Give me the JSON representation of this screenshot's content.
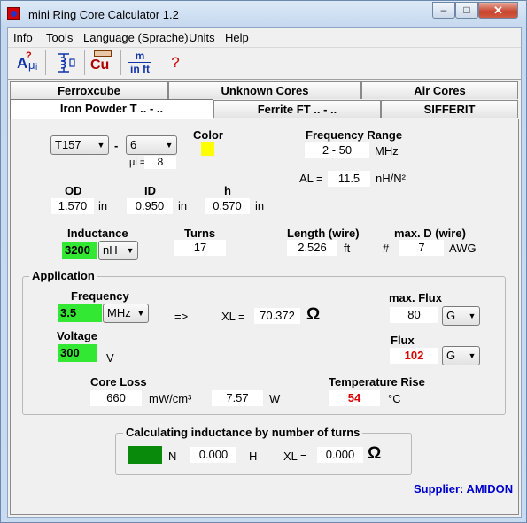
{
  "window": {
    "title": "mini Ring Core Calculator 1.2",
    "buttons": {
      "minimize": "–",
      "maximize": "□",
      "close": "✕"
    }
  },
  "menu": [
    "Info",
    "Tools",
    "Language (Sprache)",
    "Units",
    "Help"
  ],
  "toolbar": {
    "b1_a": "A",
    "b1_b": "?",
    "b1_c": "μ",
    "b1_d": "i",
    "b3": "Cu",
    "b4_top": "m",
    "b4_bottom": "in ft",
    "b5": "?"
  },
  "tabs": {
    "row1": [
      "Ferroxcube",
      "Unknown Cores",
      "Air Cores"
    ],
    "row2": [
      "Iron Powder T .. - ..",
      "Ferrite FT .. - ..",
      "SIFFERIT"
    ],
    "active": "Iron Powder T .. - .."
  },
  "core": {
    "type": "T157",
    "dash": "-",
    "mix": "6",
    "mu_label": "μi =",
    "mu_value": "8",
    "color_label": "Color",
    "color": "#ffff00"
  },
  "frequency_range": {
    "label": "Frequency Range",
    "value": "2 - 50",
    "unit": "MHz"
  },
  "al": {
    "label": "AL =",
    "value": "11.5",
    "unit": "nH/N²"
  },
  "dimensions": {
    "od_label": "OD",
    "od_value": "1.570",
    "od_unit": "in",
    "id_label": "ID",
    "id_value": "0.950",
    "id_unit": "in",
    "h_label": "h",
    "h_value": "0.570",
    "h_unit": "in"
  },
  "inductance": {
    "label": "Inductance",
    "value": "3200",
    "unit": "nH"
  },
  "turns": {
    "label": "Turns",
    "value": "17"
  },
  "length": {
    "label": "Length (wire)",
    "value": "2.526",
    "unit": "ft"
  },
  "maxd": {
    "label": "max. D (wire)",
    "prefix": "#",
    "value": "7",
    "unit": "AWG"
  },
  "application": {
    "title": "Application",
    "frequency_label": "Frequency",
    "frequency_value": "3.5",
    "frequency_unit": "MHz",
    "arrow": "=>",
    "xl_label": "XL =",
    "xl_value": "70.372",
    "xl_unit": "Ω",
    "voltage_label": "Voltage",
    "voltage_value": "300",
    "voltage_unit": "V",
    "maxflux_label": "max. Flux",
    "maxflux_value": "80",
    "maxflux_unit": "G",
    "flux_label": "Flux",
    "flux_value": "102",
    "flux_unit": "G",
    "coreloss_label": "Core Loss",
    "coreloss_value": "660",
    "coreloss_unit": "mW/cm³",
    "power_value": "7.57",
    "power_unit": "W",
    "temp_label": "Temperature Rise",
    "temp_value": "54",
    "temp_unit": "°C"
  },
  "calc": {
    "title": "Calculating inductance by number of turns",
    "n_label": "N",
    "h_value": "0.000",
    "h_unit": "H",
    "xl_label": "XL =",
    "xl_value": "0.000",
    "xl_unit": "Ω"
  },
  "supplier": "Supplier: AMIDON",
  "colors": {
    "green": "#33e833",
    "red": "#dd0000",
    "supplier": "#0000cc",
    "dark_green": "#0a8a0a"
  }
}
